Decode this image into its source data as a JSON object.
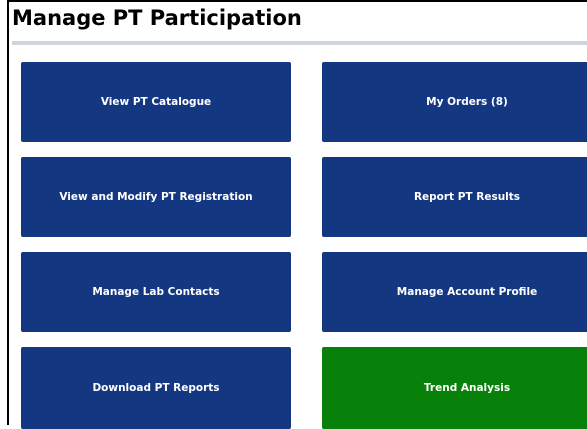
{
  "page": {
    "title": "Manage PT Participation"
  },
  "tiles": [
    {
      "label": "View PT Catalogue",
      "color": "#143782"
    },
    {
      "label": "My Orders (8)",
      "color": "#143782"
    },
    {
      "label": "View and Modify PT Registration",
      "color": "#143782"
    },
    {
      "label": "Report PT Results",
      "color": "#143782"
    },
    {
      "label": "Manage Lab Contacts",
      "color": "#143782"
    },
    {
      "label": "Manage Account Profile",
      "color": "#143782"
    },
    {
      "label": "Download PT Reports",
      "color": "#143782"
    },
    {
      "label": "Trend Analysis",
      "color": "#07810a"
    }
  ],
  "colors": {
    "primary_tile": "#143782",
    "highlight_tile": "#07810a",
    "title_rule": "#cfd4e0"
  }
}
